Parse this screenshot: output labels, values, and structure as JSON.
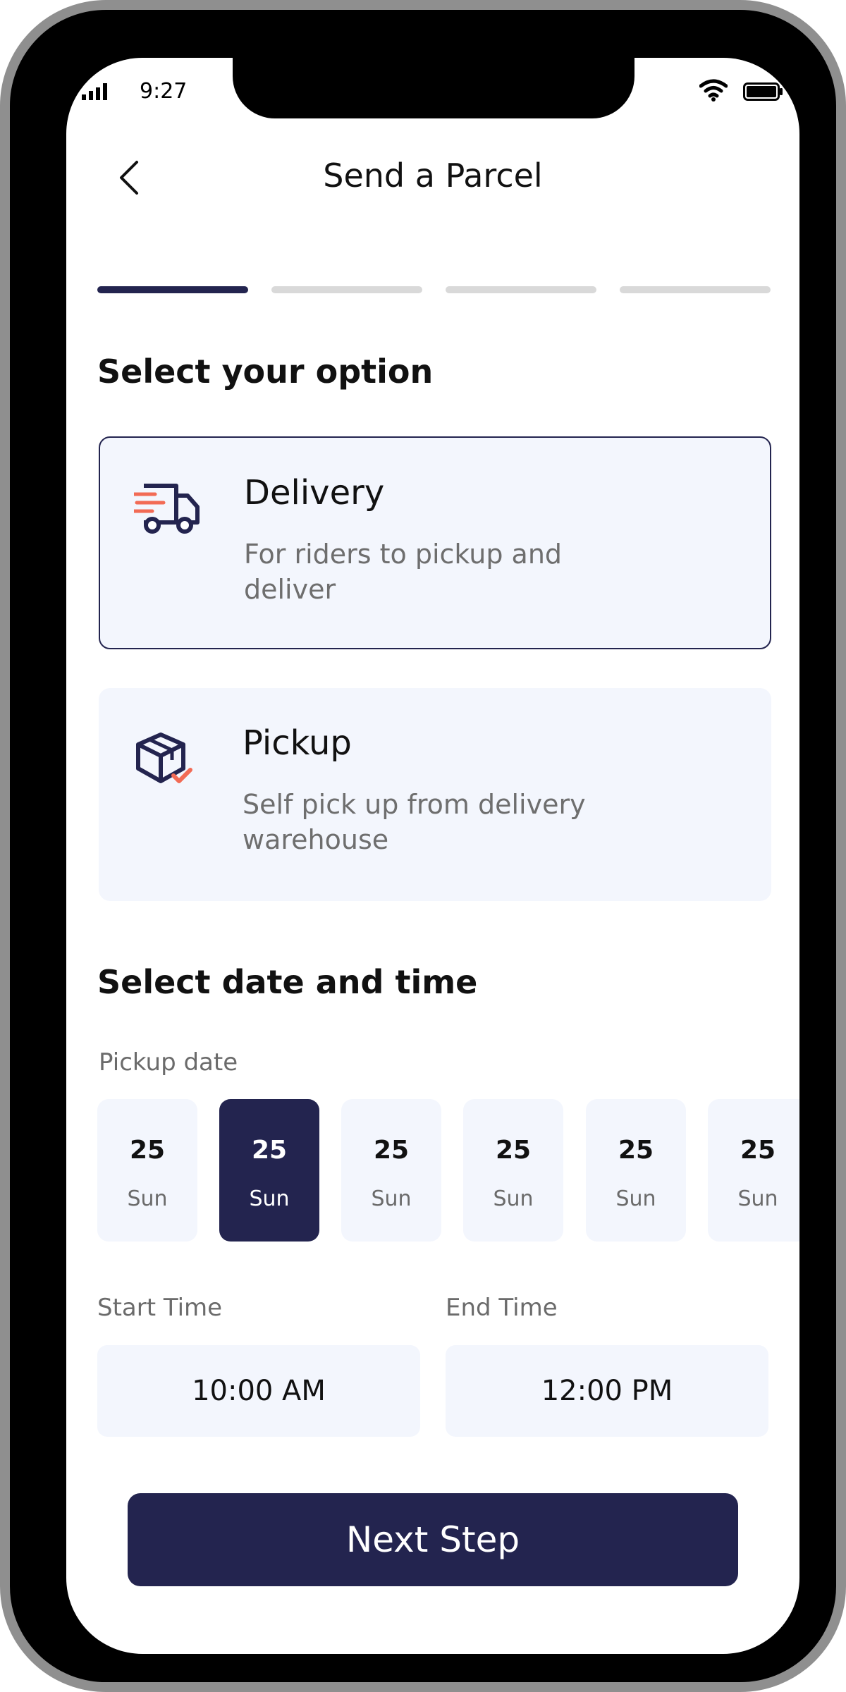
{
  "status_bar": {
    "time": "9:27"
  },
  "header": {
    "title": "Send a Parcel"
  },
  "progress": {
    "total_steps": 4,
    "current_step": 1,
    "active_color": "#23244f",
    "inactive_color": "#d9d9d9"
  },
  "options": {
    "section_title": "Select your option",
    "delivery": {
      "title": "Delivery",
      "description": "For riders to pickup and deliver",
      "icon": "truck-icon",
      "selected": true
    },
    "pickup": {
      "title": "Pickup",
      "description": "Self pick up from delivery warehouse",
      "icon": "box-check-icon",
      "selected": false
    }
  },
  "schedule": {
    "section_title": "Select date and time",
    "pickup_date_label": "Pickup date",
    "dates": [
      {
        "day_num": "25",
        "day_name": "Sun",
        "selected": false
      },
      {
        "day_num": "25",
        "day_name": "Sun",
        "selected": true
      },
      {
        "day_num": "25",
        "day_name": "Sun",
        "selected": false
      },
      {
        "day_num": "25",
        "day_name": "Sun",
        "selected": false
      },
      {
        "day_num": "25",
        "day_name": "Sun",
        "selected": false
      },
      {
        "day_num": "25",
        "day_name": "Sun",
        "selected": false
      }
    ],
    "start_time_label": "Start Time",
    "start_time": "10:00 AM",
    "end_time_label": "End Time",
    "end_time": "12:00 PM"
  },
  "actions": {
    "next_label": "Next Step"
  },
  "colors": {
    "primary": "#23244f",
    "card_bg": "#f3f6fd",
    "accent": "#f26b55"
  }
}
